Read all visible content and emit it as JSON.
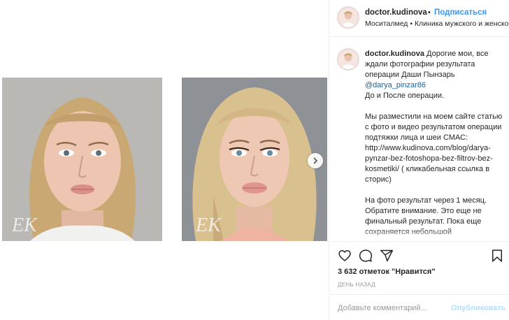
{
  "post": {
    "username": "doctor.kudinova",
    "dot": "•",
    "follow_label": "Подписаться",
    "location": "Моситалмед • Клиника мужского и женского здоровья"
  },
  "caption": {
    "username": "doctor.kudinova",
    "line1": "Дорогие мои, все ждали фотографии результата операции Даши Пынзарь",
    "mention": "@darya_pinzar86",
    "line2": "До и После операции.",
    "para2": "Мы разместили на моем сайте статью с фото и видео результатом операции подтяжки лица и шеи СМАС:",
    "link": "http://www.kudinova.com/blog/darya-pynzar-bez-fotoshopa-bez-filtrov-bez-kosmetiki/",
    "link_note": " ( кликабельная ссылка в сторис)",
    "para3": "На фото результат через 1 месяц. Обратите внимание. Это еще не финальный результат. Пока еще сохраняется небольшой"
  },
  "media": {
    "watermark": "EK",
    "icons": {
      "next": "chevron-right-icon"
    }
  },
  "actions": {
    "icons": [
      "heart-icon",
      "comment-icon",
      "share-icon",
      "bookmark-icon"
    ]
  },
  "likes_text": "3 632 отметок \"Нравится\"",
  "time_text": "ДЕНЬ НАЗАД",
  "add_comment": {
    "placeholder": "Добавьте комментарий...",
    "publish_label": "Опубликовать"
  },
  "colors": {
    "accent": "#3897f0",
    "publish_disabled": "#b2dffc",
    "muted": "#999999"
  }
}
